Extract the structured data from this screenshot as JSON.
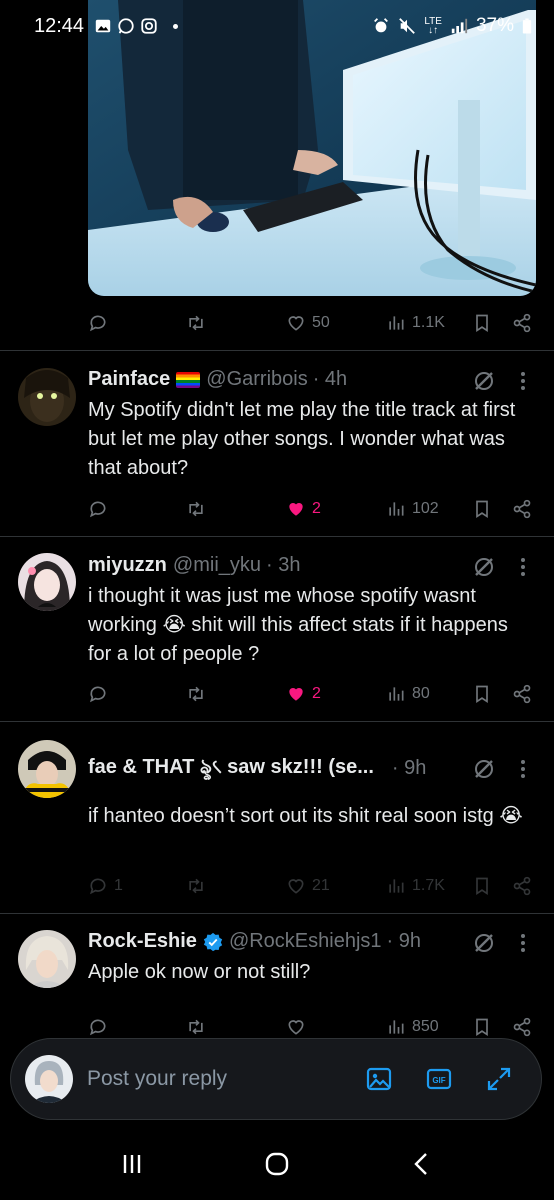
{
  "status_bar": {
    "time": "12:44",
    "network": "LTE",
    "battery": "37%"
  },
  "first_tweet_actions": {
    "likes": "50",
    "views": "1.1K"
  },
  "tweets": [
    {
      "name": "Painface",
      "has_flag": true,
      "handle": "@Garribois",
      "time": "· 4h",
      "text": "My Spotify didn't let me play the title track at first but let me play other songs. I wonder what was that about?",
      "replies": "",
      "likes": "2",
      "liked": true,
      "views": "102"
    },
    {
      "name": "miyuzzn",
      "handle": "@mii_yku",
      "time": "· 3h",
      "text": "i thought it was just me whose spotify wasnt working 😭 shit will this affect stats if it happens for a lot of people ?",
      "replies": "",
      "likes": "2",
      "liked": true,
      "views": "80"
    },
    {
      "name": "fae & THAT ৡ৻ saw skz!!! (se...",
      "handle": "",
      "time": "· 9h",
      "text": "if hanteo doesn’t sort out its shit real soon istg 😭",
      "replies": "1",
      "likes": "21",
      "liked": false,
      "views": "1.7K"
    },
    {
      "name": "Rock-Eshie",
      "verified": true,
      "handle": "@RockEshiehjs1",
      "time": "· 9h",
      "text": "Apple ok now or not still?",
      "replies": "",
      "likes": "",
      "liked": false,
      "views": "850"
    }
  ],
  "reply_bar": {
    "placeholder": "Post your reply"
  },
  "colors": {
    "accent": "#1d9bf0",
    "like": "#f91880",
    "muted": "#71767b",
    "background": "#000000"
  }
}
